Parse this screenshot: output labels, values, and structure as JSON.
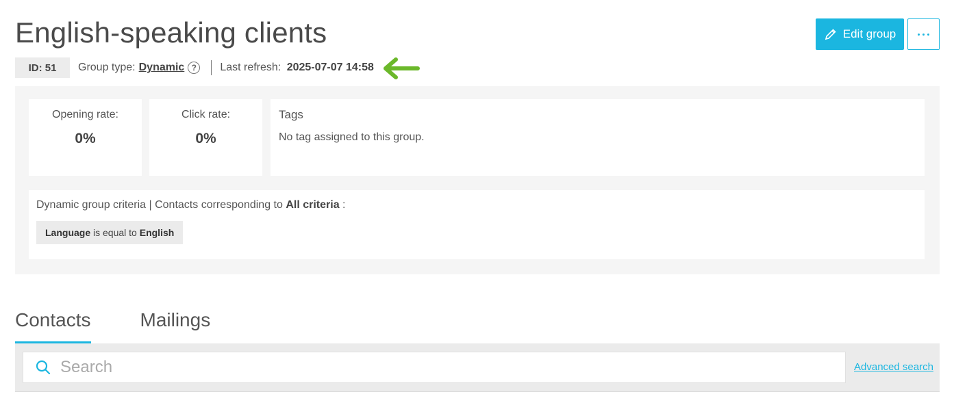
{
  "header": {
    "title": "English-speaking clients",
    "edit_label": "Edit group",
    "more_label": "⋯",
    "accent": "#1bb6e0"
  },
  "meta": {
    "id_label": "ID: 51",
    "group_type_label": "Group type:",
    "group_type_value": "Dynamic",
    "help_glyph": "?",
    "last_refresh_label": "Last refresh:",
    "last_refresh_value": "2025-07-07 14:58",
    "arrow_color": "#6bb82a"
  },
  "stats": {
    "opening_label": "Opening rate:",
    "opening_value": "0%",
    "click_label": "Click rate:",
    "click_value": "0%"
  },
  "tags": {
    "label": "Tags",
    "empty_text": "No tag assigned to this group."
  },
  "criteria": {
    "prefix": "Dynamic group criteria | Contacts corresponding to",
    "match": "All criteria",
    "suffix": ":",
    "rule_field": "Language",
    "rule_op": "is equal to",
    "rule_value": "English"
  },
  "tabs": [
    {
      "label": "Contacts",
      "active": true
    },
    {
      "label": "Mailings",
      "active": false
    }
  ],
  "search": {
    "placeholder": "Search",
    "advanced_label": "Advanced search"
  }
}
